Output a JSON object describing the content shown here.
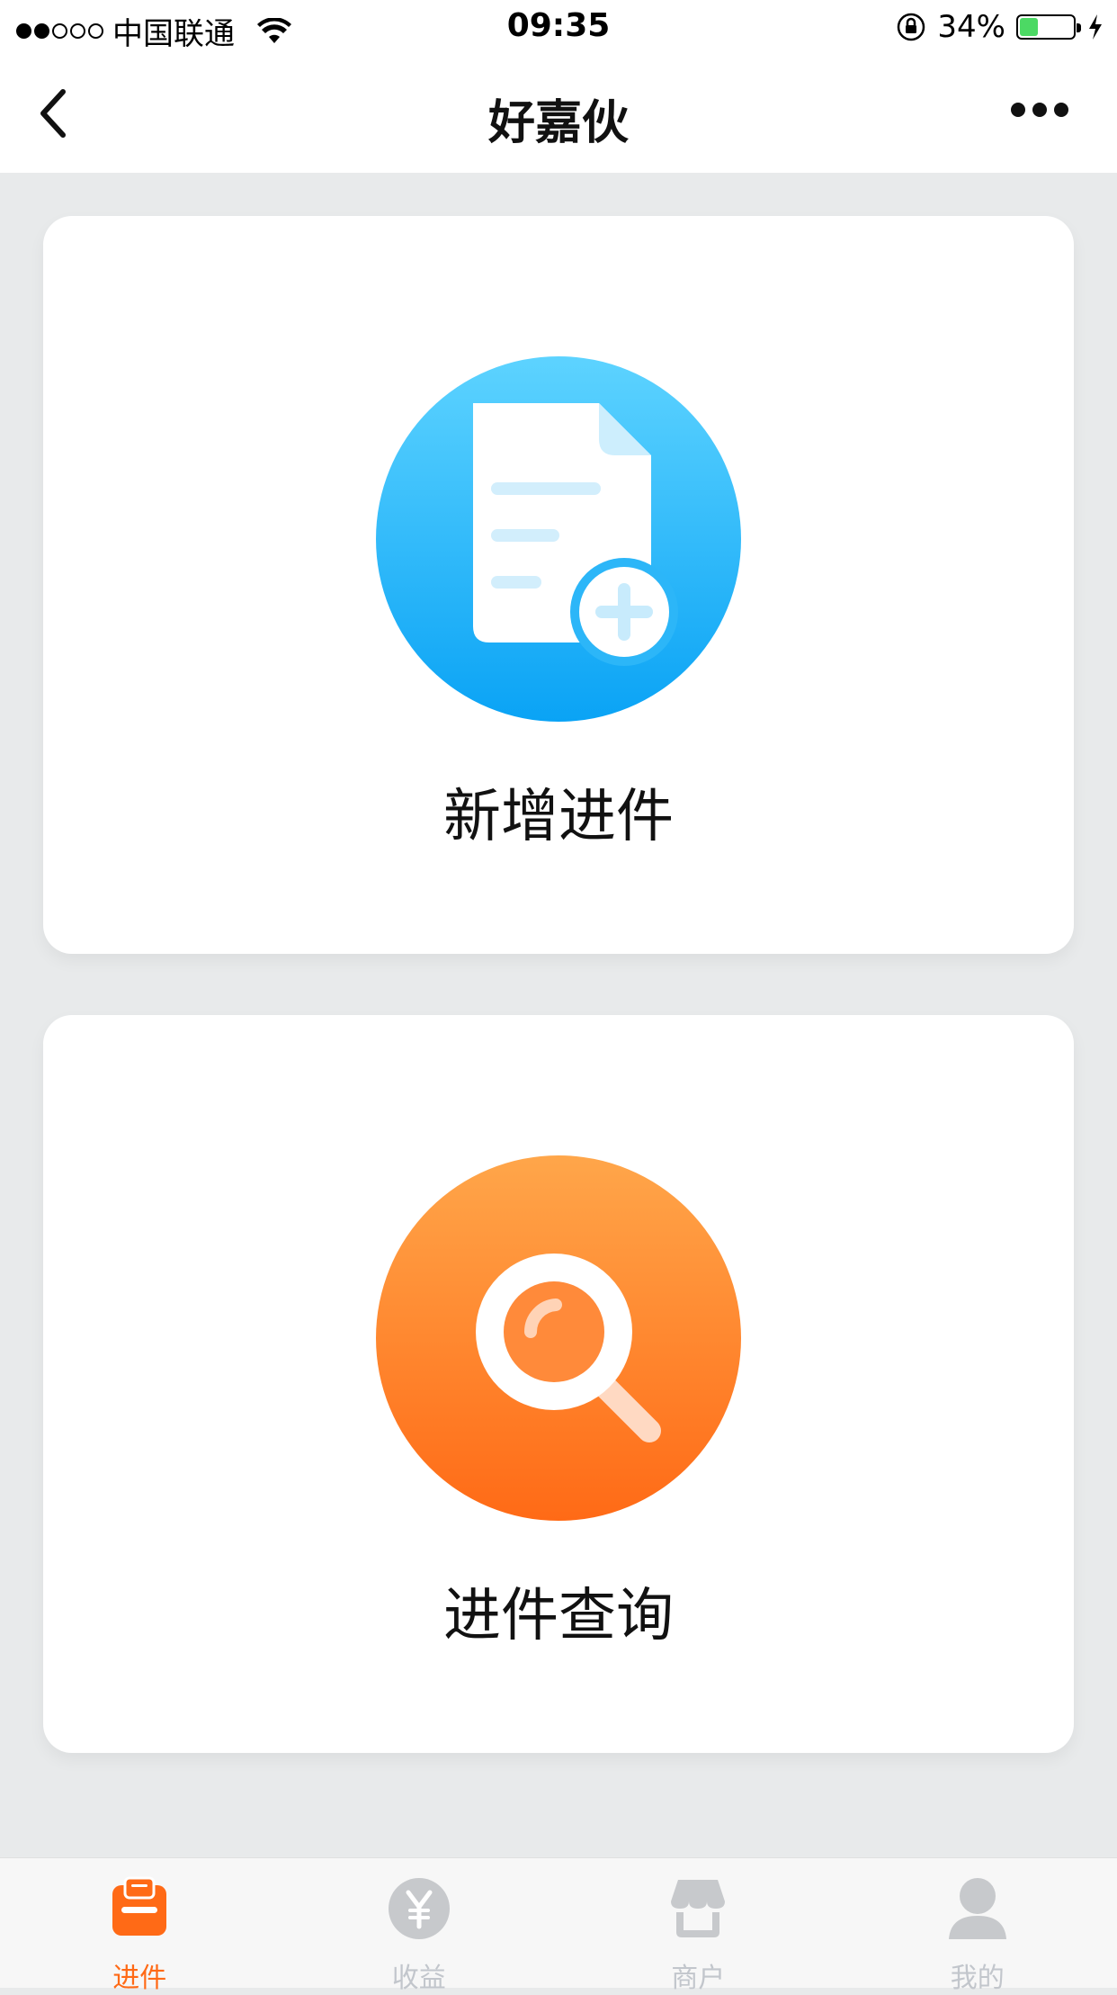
{
  "status_bar": {
    "carrier": "中国联通",
    "time": "09:35",
    "battery": "34%",
    "battery_level": 0.34
  },
  "nav": {
    "title": "好嘉伙"
  },
  "cards": [
    {
      "label": "新增进件",
      "icon": "document-add-icon",
      "color": "#0aa3f5"
    },
    {
      "label": "进件查询",
      "icon": "search-icon",
      "color": "#ff6a16"
    }
  ],
  "tabs": [
    {
      "label": "进件",
      "icon": "clipboard-icon",
      "active": true
    },
    {
      "label": "收益",
      "icon": "yen-coin-icon",
      "active": false
    },
    {
      "label": "商户",
      "icon": "shop-icon",
      "active": false
    },
    {
      "label": "我的",
      "icon": "user-icon",
      "active": false
    }
  ],
  "colors": {
    "accent": "#ff6a16",
    "inactive": "#c2c6cc",
    "background": "#e8eaeb"
  }
}
